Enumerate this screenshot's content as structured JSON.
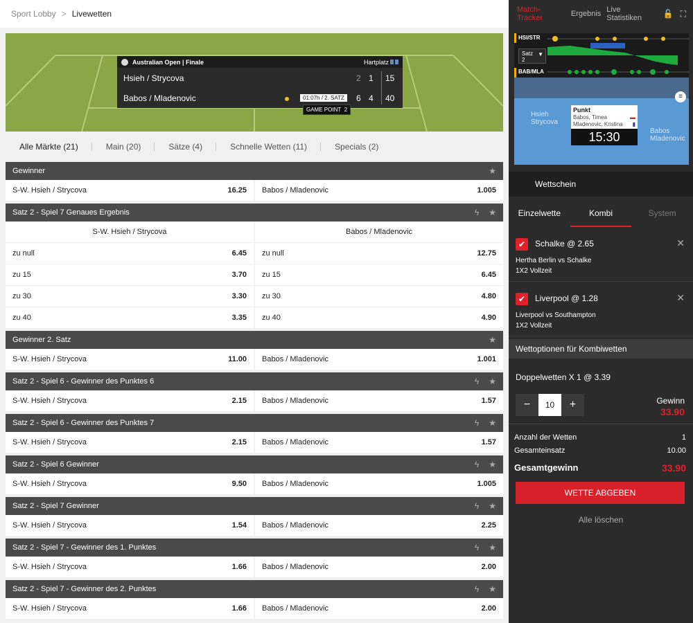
{
  "breadcrumb": {
    "root": "Sport Lobby",
    "separator": ">",
    "current": "Livewetten"
  },
  "scoreboard": {
    "tournament": "Australian Open | Finale",
    "surface": "Hartplatz",
    "team1": {
      "name": "Hsieh / Strycova",
      "set1": "2",
      "set2": "1",
      "points": "15"
    },
    "team2": {
      "name": "Babos / Mladenovic",
      "set1": "6",
      "set2": "4",
      "points": "40"
    },
    "time": "01:07h / 2. SATZ",
    "game_point": "GAME POINT",
    "game_point_num": "2"
  },
  "market_tabs": [
    {
      "label": "Alle Märkte (21)",
      "active": true
    },
    {
      "label": "Main (20)"
    },
    {
      "label": "Sätze (4)"
    },
    {
      "label": "Schnelle Wetten (11)"
    },
    {
      "label": "Specials (2)"
    }
  ],
  "markets": {
    "m0": {
      "title": "Gewinner",
      "row": {
        "a": "S-W. Hsieh / Strycova",
        "ao": "16.25",
        "b": "Babos / Mladenovic",
        "bo": "1.005"
      }
    },
    "m1": {
      "title": "Satz 2 - Spiel 7 Genaues Ergebnis",
      "col_a": "S-W. Hsieh / Strycova",
      "col_b": "Babos / Mladenovic",
      "rows": [
        {
          "a": "zu null",
          "ao": "6.45",
          "b": "zu null",
          "bo": "12.75"
        },
        {
          "a": "zu 15",
          "ao": "3.70",
          "b": "zu 15",
          "bo": "6.45"
        },
        {
          "a": "zu 30",
          "ao": "3.30",
          "b": "zu 30",
          "bo": "4.80"
        },
        {
          "a": "zu 40",
          "ao": "3.35",
          "b": "zu 40",
          "bo": "4.90"
        }
      ]
    },
    "m2": {
      "title": "Gewinner 2. Satz",
      "row": {
        "a": "S-W. Hsieh / Strycova",
        "ao": "11.00",
        "b": "Babos / Mladenovic",
        "bo": "1.001"
      }
    },
    "m3": {
      "title": "Satz 2 - Spiel 6 - Gewinner des Punktes 6",
      "row": {
        "a": "S-W. Hsieh / Strycova",
        "ao": "2.15",
        "b": "Babos / Mladenovic",
        "bo": "1.57"
      }
    },
    "m4": {
      "title": "Satz 2 - Spiel 6 - Gewinner des Punktes 7",
      "row": {
        "a": "S-W. Hsieh / Strycova",
        "ao": "2.15",
        "b": "Babos / Mladenovic",
        "bo": "1.57"
      }
    },
    "m5": {
      "title": "Satz 2 - Spiel 6 Gewinner",
      "row": {
        "a": "S-W. Hsieh / Strycova",
        "ao": "9.50",
        "b": "Babos / Mladenovic",
        "bo": "1.005"
      }
    },
    "m6": {
      "title": "Satz 2 - Spiel 7 Gewinner",
      "row": {
        "a": "S-W. Hsieh / Strycova",
        "ao": "1.54",
        "b": "Babos / Mladenovic",
        "bo": "2.25"
      }
    },
    "m7": {
      "title": "Satz 2 - Spiel 7 - Gewinner des 1. Punktes",
      "row": {
        "a": "S-W. Hsieh / Strycova",
        "ao": "1.66",
        "b": "Babos / Mladenovic",
        "bo": "2.00"
      }
    },
    "m8": {
      "title": "Satz 2 - Spiel 7 - Gewinner des 2. Punktes",
      "row": {
        "a": "S-W. Hsieh / Strycova",
        "ao": "1.66",
        "b": "Babos / Mladenovic",
        "bo": "2.00"
      }
    }
  },
  "tracker": {
    "tabs": [
      "Match-Tracker",
      "Ergebnis",
      "Live Statistiken"
    ],
    "label_top": "HSI/STR",
    "label_bottom": "BAB/MLA",
    "satz_label": "Satz",
    "satz_value": "2",
    "court_team1": "Hsieh Strycova",
    "court_team2": "Babos Mladenovic",
    "card_title": "Punkt",
    "card_player1": "Babos, Timea",
    "card_player2": "Mladenovic, Kristina",
    "clock": "15:30"
  },
  "slip": {
    "title": "Wettschein",
    "tabs": [
      "Einzelwette",
      "Kombi",
      "System"
    ],
    "bets": [
      {
        "selection": "Schalke @ 2.65",
        "match": "Hertha Berlin  vs  Schalke",
        "type": "1X2 Vollzeit"
      },
      {
        "selection": "Liverpool @ 1.28",
        "match": "Liverpool  vs  Southampton",
        "type": "1X2 Vollzeit"
      }
    ],
    "kombi_title": "Wettoptionen für Kombiwetten",
    "doppel": "Doppelwetten X  1  @  3.39",
    "stake": "10",
    "gewinn_label": "Gewinn",
    "gewinn_value": "33.90",
    "anzahl_label": "Anzahl der Wetten",
    "anzahl_value": "1",
    "einsatz_label": "Gesamteinsatz",
    "einsatz_value": "10.00",
    "gesamt_label": "Gesamtgewinn",
    "gesamt_value": "33.90",
    "submit": "WETTE ABGEBEN",
    "clear": "Alle löschen"
  },
  "colors": {
    "accent": "#e0202a",
    "court": "#8aa646",
    "dark": "#2b2b2b"
  }
}
